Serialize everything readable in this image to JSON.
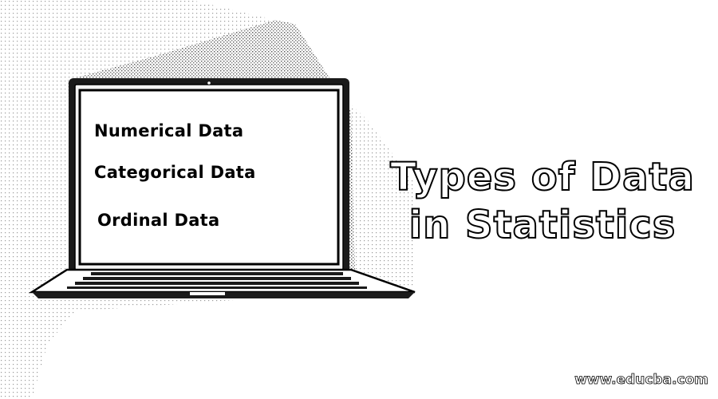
{
  "screen": {
    "items": [
      "Numerical Data",
      "Categorical Data",
      "Ordinal Data"
    ]
  },
  "headline": {
    "line1": "Types of Data",
    "line2": "in Statistics"
  },
  "footer": {
    "url": "www.educba.com"
  }
}
